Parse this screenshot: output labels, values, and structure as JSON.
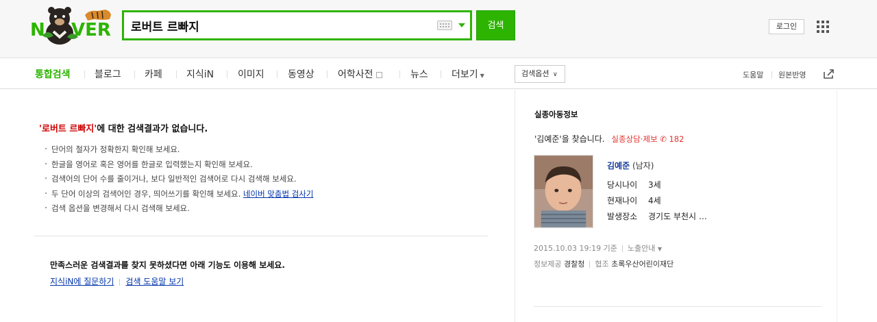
{
  "header": {
    "logo_text": "NAVER",
    "search_value": "로버트 르빠지",
    "search_button": "검색",
    "login_button": "로그인"
  },
  "nav": {
    "tabs": [
      "통합검색",
      "블로그",
      "카페",
      "지식iN",
      "이미지",
      "동영상",
      "어학사전",
      "뉴스",
      "더보기"
    ],
    "search_options": "검색옵션",
    "help": "도움말",
    "feedback": "원본반영"
  },
  "main": {
    "query_quoted": "'로버트 르빠지'",
    "no_result_suffix": "에 대한 검색결과가 없습니다.",
    "tips": [
      "단어의 철자가 정확한지 확인해 보세요.",
      "한글을 영어로 혹은 영어를 한글로 입력했는지 확인해 보세요.",
      "검색어의 단어 수를 줄이거나, 보다 일반적인 검색어로 다시 검색해 보세요.",
      "두 단어 이상의 검색어인 경우, 띄어쓰기를 확인해 보세요.",
      "검색 옵션을 변경해서 다시 검색해 보세요."
    ],
    "spell_check_link": "네이버 맞춤법 검사기",
    "satisfaction_text": "만족스러운 검색결과를 찾지 못하셨다면 아래 기능도 이용해 보세요.",
    "link_ask": "지식iN에 질문하기",
    "link_help": "검색 도움말 보기"
  },
  "panel": {
    "title": "실종아동정보",
    "find_text": "'김예준'을 찾습니다.",
    "report_label": "실종상담·제보",
    "report_number": "182",
    "child_name": "김예준",
    "child_gender": "(남자)",
    "info": [
      {
        "key": "당시나이",
        "value": "3세"
      },
      {
        "key": "현재나이",
        "value": "4세"
      },
      {
        "key": "발생장소",
        "value": "경기도 부천시 …"
      }
    ],
    "timestamp": "2015.10.03 19:19 기준",
    "exposure": "노출안내",
    "provider_label": "정보제공",
    "provider": "경찰청",
    "coop_label": "협조",
    "coop": "초록우산어린이재단"
  },
  "colors": {
    "brand_green": "#2db400",
    "alert_red": "#e0312e",
    "link_blue": "#0033aa"
  }
}
